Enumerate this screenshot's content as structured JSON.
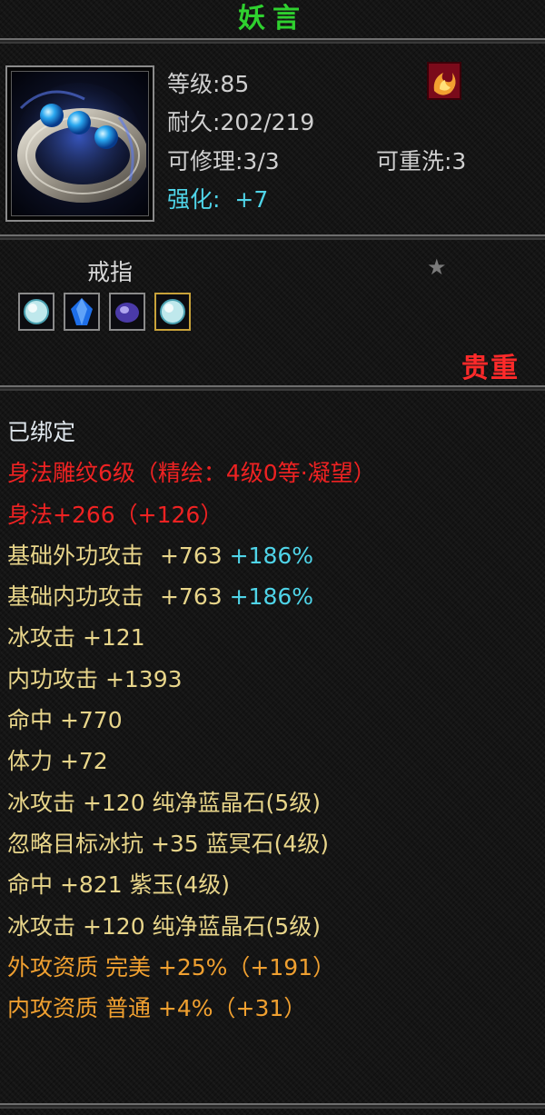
{
  "title": "妖言",
  "header": {
    "level": "等级:85",
    "durability": "耐久:202/219",
    "repairable": "可修理:3/3",
    "rewash": "可重洗:3",
    "enhance_label": "强化:",
    "enhance_value": "+7"
  },
  "item_type": "戒指",
  "rarity": "贵重",
  "bound": "已绑定",
  "engraving": "身法雕纹6级（精绘：4级0等·凝望）",
  "agility": "身法+266（+126）",
  "attributes": [
    {
      "label": "基础外功攻击",
      "value": "+763",
      "extra": "+186%"
    },
    {
      "label": "基础内功攻击",
      "value": "+763",
      "extra": "+186%"
    },
    {
      "text": "冰攻击 +121"
    },
    {
      "text": "内功攻击 +1393"
    },
    {
      "text": "命中 +770"
    },
    {
      "text": "体力 +72"
    },
    {
      "text": "冰攻击 +120 纯净蓝晶石(5级)"
    },
    {
      "text": "忽略目标冰抗 +35 蓝冥石(4级)"
    },
    {
      "text": "命中 +821 紫玉(4级)"
    },
    {
      "text": "冰攻击 +120 纯净蓝晶石(5级)"
    }
  ],
  "qualities": [
    {
      "text": "外攻资质  完美 +25%（+191）"
    },
    {
      "text": "内攻资质  普通 +4%（+31）"
    }
  ],
  "icons": {
    "item": "ring-icon",
    "badge": "flame-swirl-icon",
    "star": "star-icon",
    "gems": [
      "white-jade-gem-icon",
      "blue-crystal-gem-icon",
      "purple-jade-gem-icon",
      "white-jade-gem-icon"
    ]
  },
  "colors": {
    "title": "#2fd12f",
    "enhance": "#4fd4e8",
    "rarity": "#ff2a2a",
    "bound": "#dfe6ec",
    "engraving": "#ee2222",
    "attribute": "#e8d58a",
    "quality": "#f0a030"
  }
}
